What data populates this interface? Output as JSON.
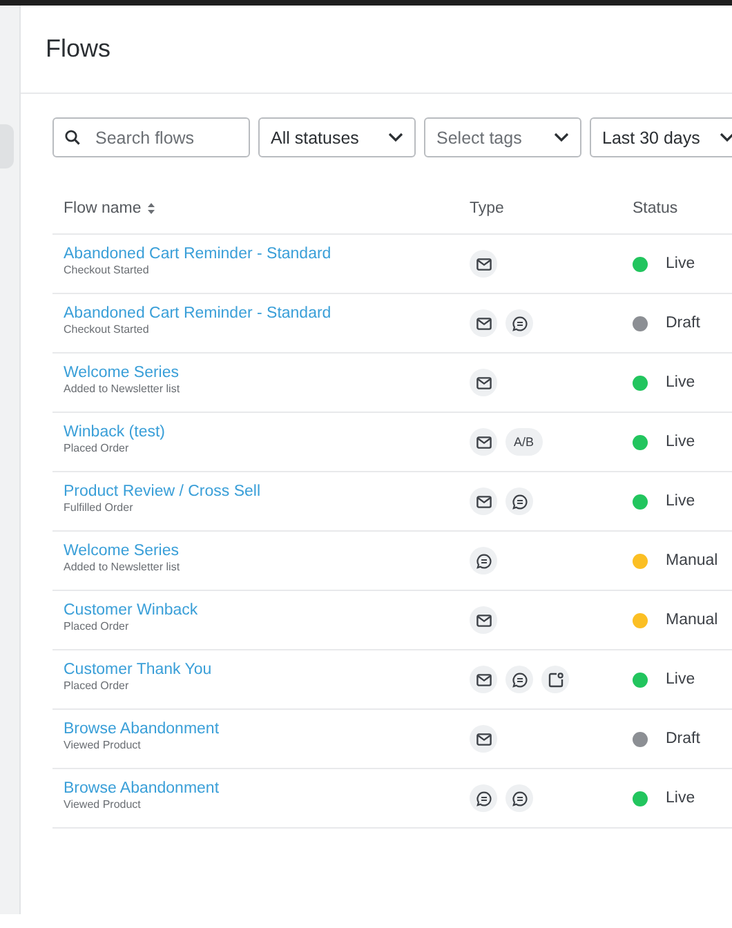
{
  "page": {
    "title": "Flows"
  },
  "filters": {
    "search": {
      "placeholder": "Search flows"
    },
    "dropdowns": [
      {
        "value": "All statuses",
        "placeholder": false
      },
      {
        "value": "Select tags",
        "placeholder": true
      },
      {
        "value": "Last 30 days",
        "placeholder": false
      }
    ]
  },
  "table": {
    "columns": [
      {
        "label": "Flow name",
        "sortable": true
      },
      {
        "label": "Type",
        "sortable": false
      },
      {
        "label": "Status",
        "sortable": false
      }
    ],
    "rows": [
      {
        "name": "Abandoned Cart Reminder - Standard",
        "trigger": "Checkout Started",
        "types": [
          {
            "kind": "email"
          }
        ],
        "status": "Live",
        "color": "#22c55e"
      },
      {
        "name": "Abandoned Cart Reminder - Standard",
        "trigger": "Checkout Started",
        "types": [
          {
            "kind": "email"
          },
          {
            "kind": "sms"
          }
        ],
        "status": "Draft",
        "color": "#8c8f94"
      },
      {
        "name": "Welcome Series",
        "trigger": "Added to Newsletter list",
        "types": [
          {
            "kind": "email"
          }
        ],
        "status": "Live",
        "color": "#22c55e"
      },
      {
        "name": "Winback (test)",
        "trigger": "Placed Order",
        "types": [
          {
            "kind": "email"
          },
          {
            "kind": "ab",
            "label": "A/B"
          }
        ],
        "status": "Live",
        "color": "#22c55e"
      },
      {
        "name": "Product Review / Cross Sell",
        "trigger": "Fulfilled Order",
        "types": [
          {
            "kind": "email"
          },
          {
            "kind": "sms"
          }
        ],
        "status": "Live",
        "color": "#22c55e"
      },
      {
        "name": "Welcome Series",
        "trigger": "Added to Newsletter list",
        "types": [
          {
            "kind": "sms"
          }
        ],
        "status": "Manual",
        "color": "#fbbf24"
      },
      {
        "name": "Customer Winback",
        "trigger": "Placed Order",
        "types": [
          {
            "kind": "email"
          }
        ],
        "status": "Manual",
        "color": "#fbbf24"
      },
      {
        "name": "Customer Thank You",
        "trigger": "Placed Order",
        "types": [
          {
            "kind": "email"
          },
          {
            "kind": "sms"
          },
          {
            "kind": "push"
          }
        ],
        "status": "Live",
        "color": "#22c55e"
      },
      {
        "name": "Browse Abandonment",
        "trigger": "Viewed Product",
        "types": [
          {
            "kind": "email"
          }
        ],
        "status": "Draft",
        "color": "#8c8f94"
      },
      {
        "name": "Browse Abandonment",
        "trigger": "Viewed Product",
        "types": [
          {
            "kind": "sms"
          },
          {
            "kind": "sms"
          }
        ],
        "status": "Live",
        "color": "#22c55e"
      }
    ]
  }
}
